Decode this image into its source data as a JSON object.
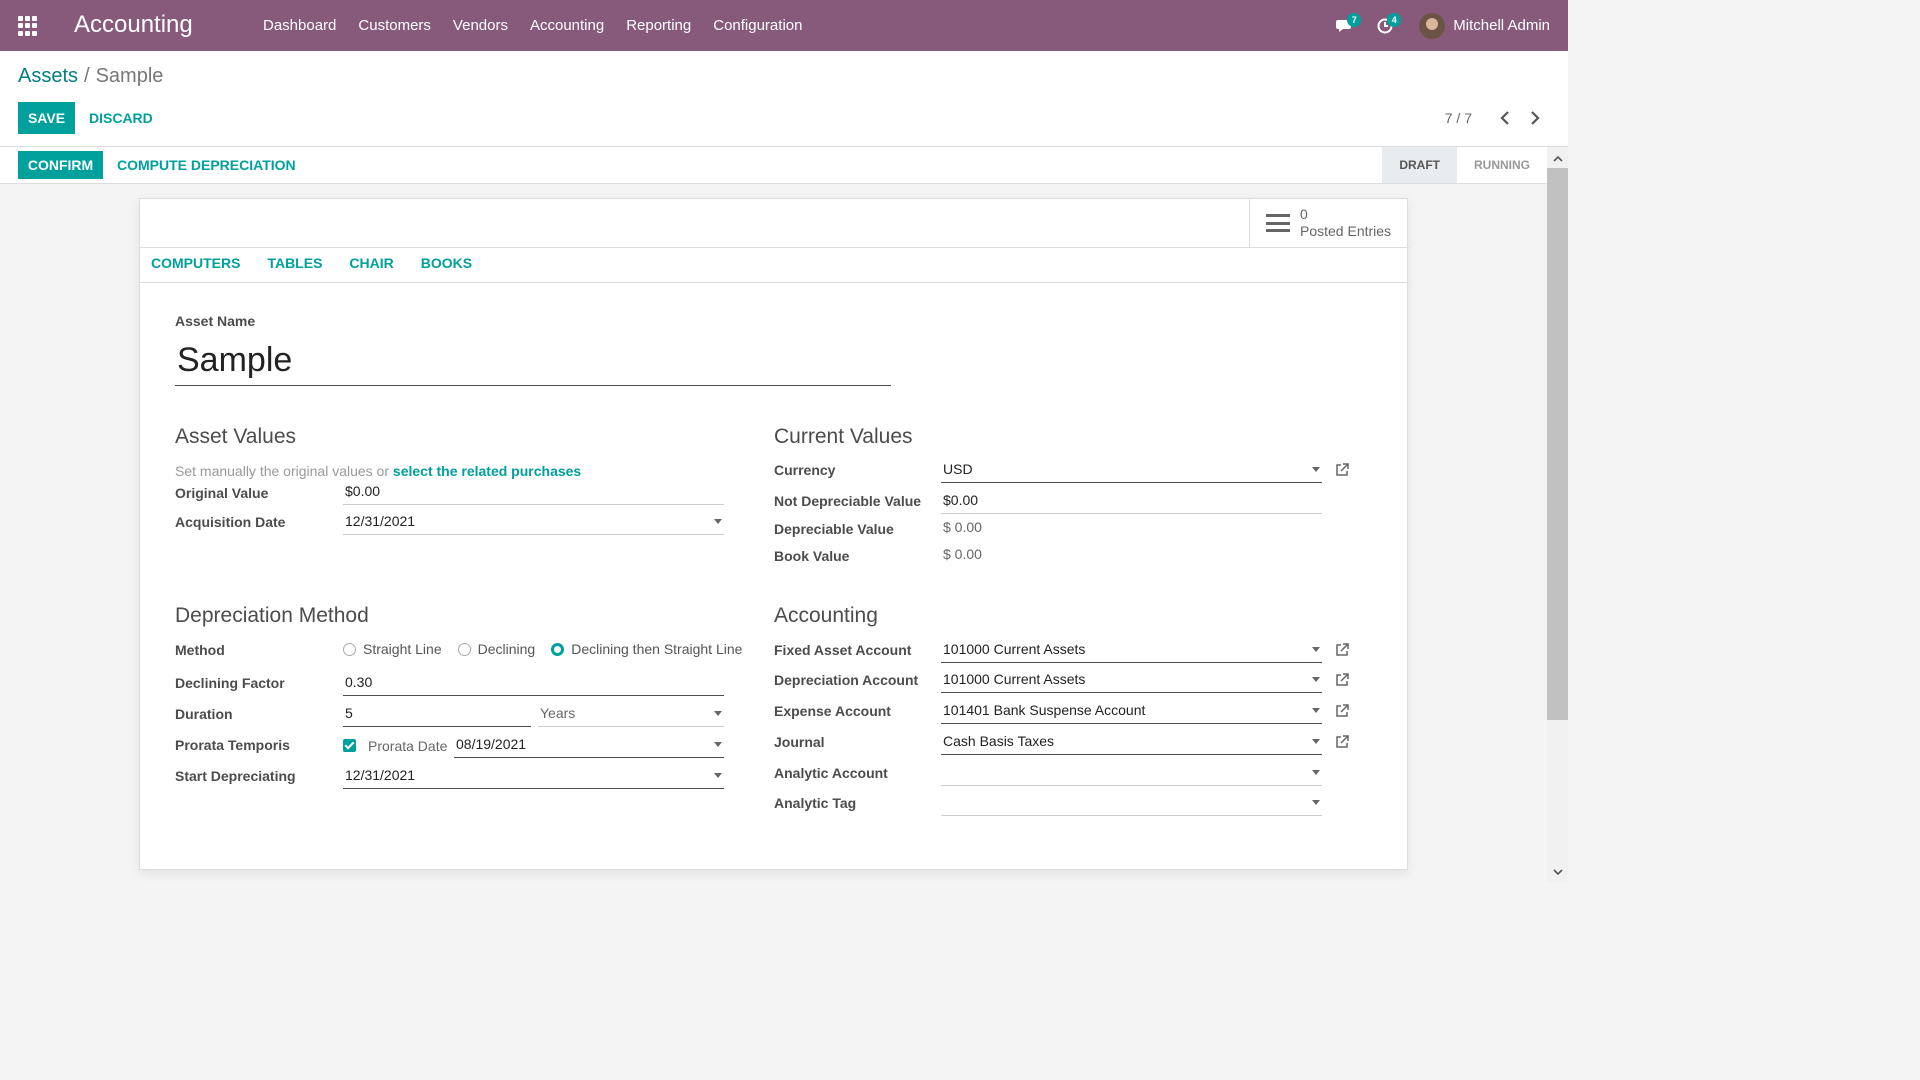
{
  "navbar": {
    "brand": "Accounting",
    "menu": [
      "Dashboard",
      "Customers",
      "Vendors",
      "Accounting",
      "Reporting",
      "Configuration"
    ],
    "messages_count": "7",
    "activities_count": "4",
    "user_name": "Mitchell Admin"
  },
  "breadcrumb": {
    "parent": "Assets",
    "separator": "/",
    "current": "Sample"
  },
  "actions": {
    "save": "SAVE",
    "discard": "DISCARD"
  },
  "pager": {
    "value": "7 / 7"
  },
  "statusbar": {
    "confirm": "CONFIRM",
    "compute": "COMPUTE DEPRECIATION",
    "stages": [
      "DRAFT",
      "RUNNING"
    ],
    "active_stage": "DRAFT"
  },
  "smart_button": {
    "count": "0",
    "label": "Posted Entries"
  },
  "tags": [
    "COMPUTERS",
    "TABLES",
    "CHAIR",
    "BOOKS"
  ],
  "asset": {
    "name_label": "Asset Name",
    "name": "Sample"
  },
  "asset_values": {
    "title": "Asset Values",
    "hint_prefix": "Set manually the original values or",
    "hint_link": "select the related purchases",
    "original_value_label": "Original Value",
    "original_value": "$0.00",
    "acquisition_date_label": "Acquisition Date",
    "acquisition_date": "12/31/2021"
  },
  "current_values": {
    "title": "Current Values",
    "currency_label": "Currency",
    "currency": "USD",
    "not_depreciable_label": "Not Depreciable Value",
    "not_depreciable": "$0.00",
    "depreciable_label": "Depreciable Value",
    "depreciable": "$ 0.00",
    "book_value_label": "Book Value",
    "book_value": "$ 0.00"
  },
  "depreciation": {
    "title": "Depreciation Method",
    "method_label": "Method",
    "methods": [
      "Straight Line",
      "Declining",
      "Declining then Straight Line"
    ],
    "selected_method": "Declining then Straight Line",
    "factor_label": "Declining Factor",
    "factor": "0.30",
    "duration_label": "Duration",
    "duration": "5",
    "duration_unit": "Years",
    "prorata_label": "Prorata Temporis",
    "prorata_checked": true,
    "prorata_date_label": "Prorata Date",
    "prorata_date": "08/19/2021",
    "start_label": "Start Depreciating",
    "start_date": "12/31/2021"
  },
  "accounting": {
    "title": "Accounting",
    "fixed_asset_label": "Fixed Asset Account",
    "fixed_asset": "101000 Current Assets",
    "depreciation_label": "Depreciation Account",
    "depreciation": "101000 Current Assets",
    "expense_label": "Expense Account",
    "expense": "101401 Bank Suspense Account",
    "journal_label": "Journal",
    "journal": "Cash Basis Taxes",
    "analytic_account_label": "Analytic Account",
    "analytic_account": "",
    "analytic_tag_label": "Analytic Tag",
    "analytic_tag": ""
  },
  "colors": {
    "navbar": "#875a7b",
    "primary": "#00a09d",
    "link": "#017e84"
  }
}
